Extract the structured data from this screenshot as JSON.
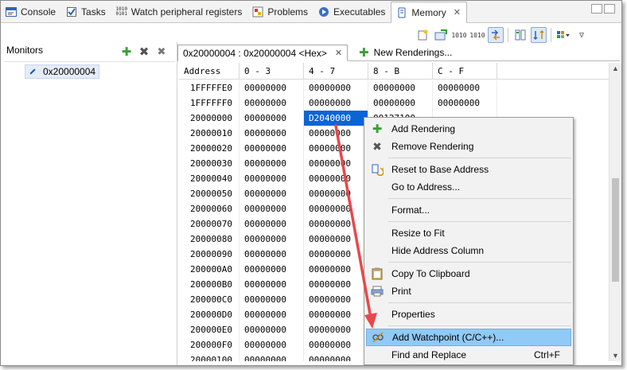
{
  "tabs": [
    {
      "label": "Console",
      "icon": "console-icon"
    },
    {
      "label": "Tasks",
      "icon": "tasks-icon"
    },
    {
      "label": "Watch peripheral registers",
      "icon": "binary-icon"
    },
    {
      "label": "Problems",
      "icon": "problems-icon"
    },
    {
      "label": "Executables",
      "icon": "executables-icon"
    },
    {
      "label": "Memory",
      "icon": "memory-icon",
      "active": true
    }
  ],
  "toolbar": {
    "binary_label_a": "1010",
    "binary_label_b": "1010"
  },
  "monitors": {
    "title": "Monitors",
    "items": [
      "0x20000004"
    ]
  },
  "renderings": {
    "active_tab": "0x20000004 : 0x20000004 <Hex>",
    "new_tab": "New Renderings..."
  },
  "memory": {
    "headers": [
      "Address",
      "0 - 3",
      "4 - 7",
      "8 - B",
      "C - F"
    ],
    "rows": [
      [
        "1FFFFFE0",
        "00000000",
        "00000000",
        "00000000",
        "00000000"
      ],
      [
        "1FFFFFF0",
        "00000000",
        "00000000",
        "00000000",
        "00000000"
      ],
      [
        "20000000",
        "00000000",
        "D2040000",
        "00127100",
        ""
      ],
      [
        "20000010",
        "00000000",
        "00000000",
        "",
        ""
      ],
      [
        "20000020",
        "00000000",
        "00000000",
        "",
        ""
      ],
      [
        "20000030",
        "00000000",
        "00000000",
        "",
        ""
      ],
      [
        "20000040",
        "00000000",
        "00000000",
        "",
        ""
      ],
      [
        "20000050",
        "00000000",
        "00000000",
        "",
        ""
      ],
      [
        "20000060",
        "00000000",
        "00000000",
        "",
        ""
      ],
      [
        "20000070",
        "00000000",
        "00000000",
        "",
        ""
      ],
      [
        "20000080",
        "00000000",
        "00000000",
        "",
        ""
      ],
      [
        "20000090",
        "00000000",
        "00000000",
        "",
        ""
      ],
      [
        "200000A0",
        "00000000",
        "00000000",
        "",
        ""
      ],
      [
        "200000B0",
        "00000000",
        "00000000",
        "",
        ""
      ],
      [
        "200000C0",
        "00000000",
        "00000000",
        "",
        ""
      ],
      [
        "200000D0",
        "00000000",
        "00000000",
        "",
        ""
      ],
      [
        "200000E0",
        "00000000",
        "00000000",
        "",
        ""
      ],
      [
        "200000F0",
        "00000000",
        "00000000",
        "",
        ""
      ],
      [
        "20000100",
        "00000000",
        "00000000",
        "",
        ""
      ]
    ],
    "selected": {
      "row": 2,
      "col": 2
    }
  },
  "context_menu": {
    "items": [
      {
        "label": "Add Rendering",
        "icon": "plus-icon"
      },
      {
        "label": "Remove Rendering",
        "icon": "x-icon"
      },
      {
        "sep": true
      },
      {
        "label": "Reset to Base Address",
        "icon": "reset-icon"
      },
      {
        "label": "Go to Address...",
        "icon": ""
      },
      {
        "sep": true
      },
      {
        "label": "Format...",
        "icon": ""
      },
      {
        "sep": true
      },
      {
        "label": "Resize to Fit",
        "icon": ""
      },
      {
        "label": "Hide Address Column",
        "icon": ""
      },
      {
        "sep": true
      },
      {
        "label": "Copy To Clipboard",
        "icon": "clipboard-icon"
      },
      {
        "label": "Print",
        "icon": "print-icon"
      },
      {
        "sep": true
      },
      {
        "label": "Properties",
        "icon": ""
      },
      {
        "sep": true
      },
      {
        "label": "Add Watchpoint (C/C++)...",
        "icon": "watchpoint-icon",
        "highlighted": true
      },
      {
        "label": "Find and Replace",
        "icon": "",
        "accel": "Ctrl+F"
      }
    ]
  },
  "colors": {
    "selection": "#0a64d6",
    "menu_highlight": "#91c9f7",
    "arrow": "#e8484b"
  }
}
